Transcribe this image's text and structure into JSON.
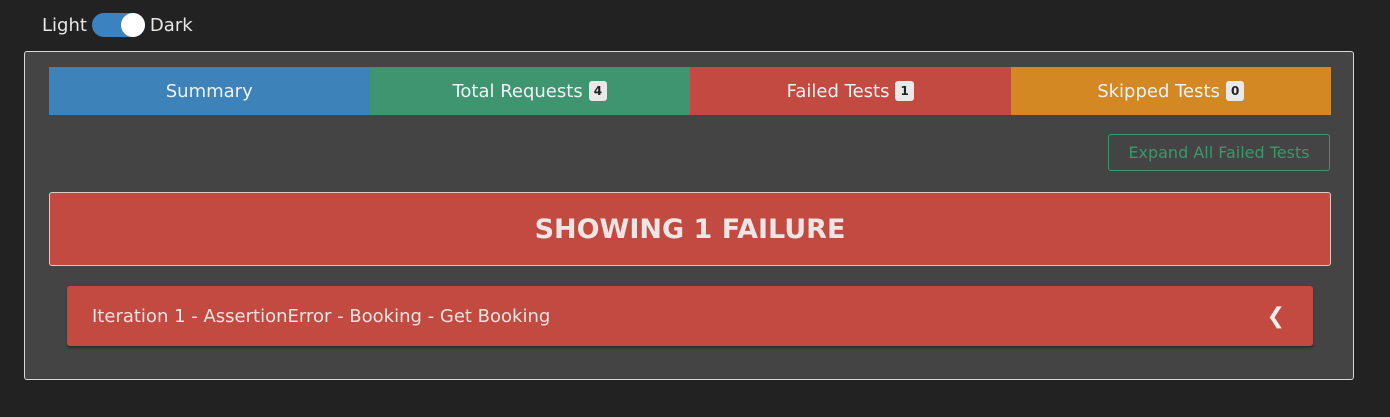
{
  "theme_toggle": {
    "light_label": "Light",
    "dark_label": "Dark",
    "state": "dark"
  },
  "tabs": [
    {
      "label": "Summary",
      "badge": null,
      "color": "#3d82b9"
    },
    {
      "label": "Total Requests",
      "badge": "4",
      "color": "#3e9570"
    },
    {
      "label": "Failed Tests",
      "badge": "1",
      "color": "#c34a40"
    },
    {
      "label": "Skipped Tests",
      "badge": "0",
      "color": "#d38823"
    }
  ],
  "actions": {
    "expand_label": "Expand All Failed Tests"
  },
  "failure_banner": {
    "text": "SHOWING 1 FAILURE"
  },
  "failures": [
    {
      "label": "Iteration 1 - AssertionError - Booking - Get Booking",
      "icon": "chevron-left-icon"
    }
  ],
  "colors": {
    "background": "#222222",
    "panel": "#444444",
    "danger": "#c34a40",
    "success": "#3e9570",
    "primary": "#3d82b9",
    "warning": "#d38823"
  }
}
